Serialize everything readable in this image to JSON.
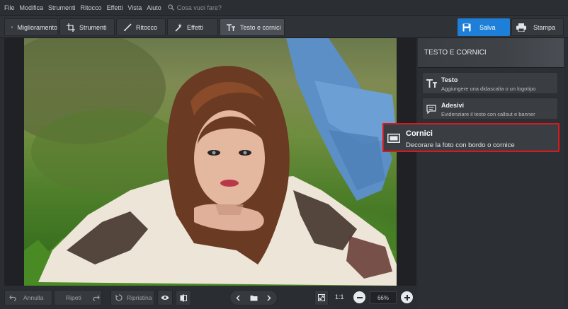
{
  "menu": {
    "items": [
      "File",
      "Modifica",
      "Strumenti",
      "Ritocco",
      "Effetti",
      "Vista",
      "Aiuto"
    ],
    "search_placeholder": "Cosa vuoi fare?"
  },
  "toolbar": {
    "tabs": [
      {
        "label": "Miglioramento",
        "icon": "sliders-icon"
      },
      {
        "label": "Strumenti",
        "icon": "crop-icon"
      },
      {
        "label": "Ritocco",
        "icon": "brush-icon"
      },
      {
        "label": "Effetti",
        "icon": "magic-wand-icon"
      },
      {
        "label": "Testo e cornici",
        "icon": "text-icon"
      }
    ],
    "active_tab": "Testo e cornici",
    "save_label": "Salva",
    "print_label": "Stampa",
    "accent_color": "#1e7fd8"
  },
  "panel": {
    "title": "TESTO E CORNICI",
    "cards": [
      {
        "title": "Testo",
        "desc": "Aggiungere una didascalia o un logotipo",
        "icon": "text-icon"
      },
      {
        "title": "Adesivi",
        "desc": "Evidenziare il testo con callout e banner",
        "icon": "speech-bubble-icon"
      },
      {
        "title": "Cornici",
        "desc": "Decorare la foto con bordo o cornice",
        "icon": "frame-icon"
      }
    ],
    "highlight_color": "#d71920"
  },
  "status": {
    "undo_label": "Annulla",
    "redo_label": "Ripeti",
    "restore_label": "Ripristina",
    "ratio_label": "1:1",
    "zoom_value": "66%"
  }
}
